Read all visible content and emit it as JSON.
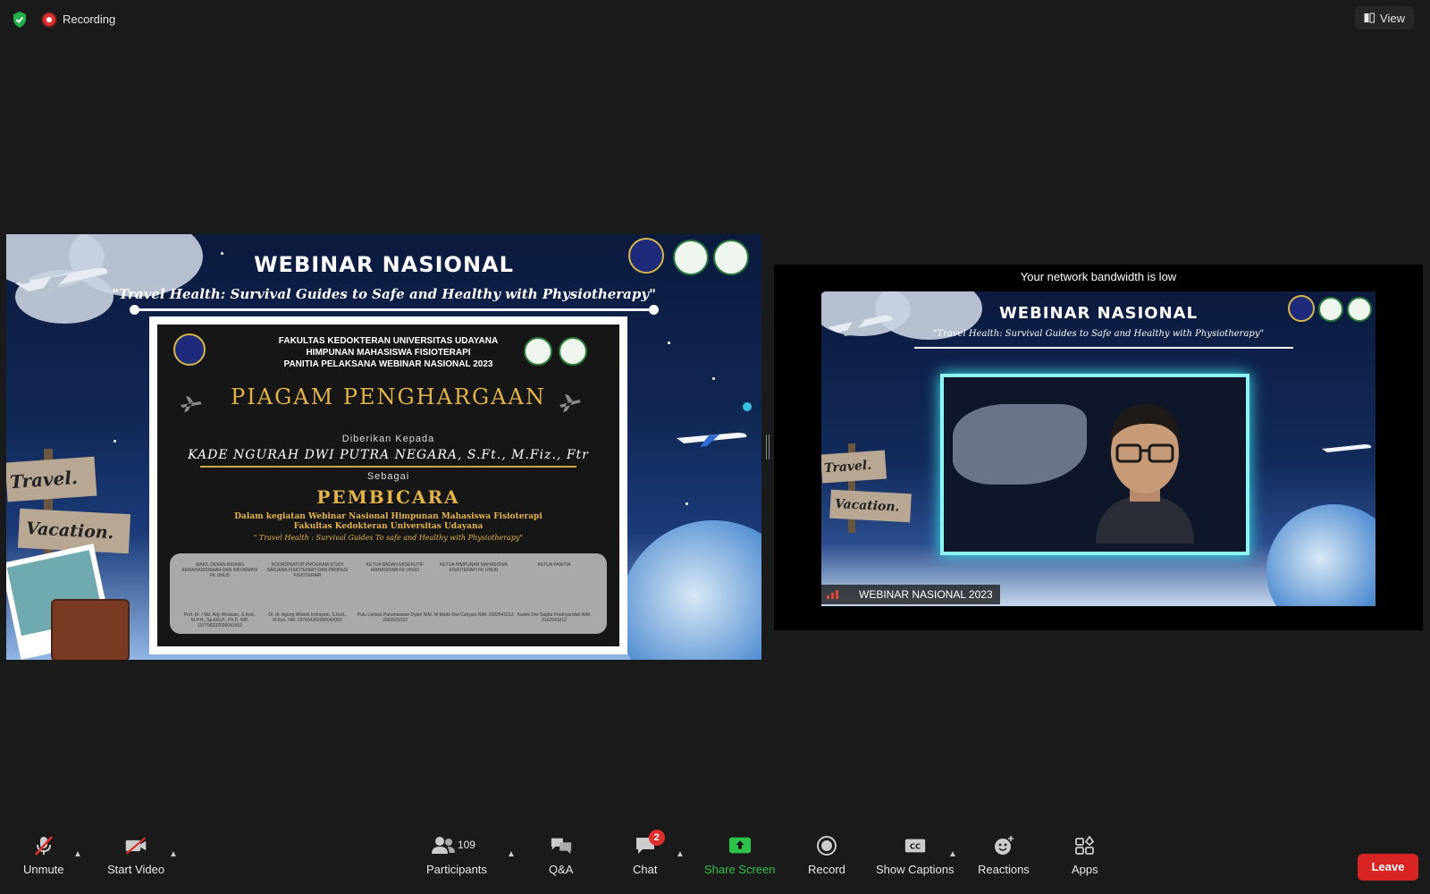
{
  "header": {
    "recording_label": "Recording",
    "view_label": "View"
  },
  "shared_slide": {
    "title": "WEBINAR NASIONAL",
    "subtitle": "\"Travel Health: Survival Guides to Safe and Healthy with Physiotherapy\"",
    "certificate": {
      "org_lines": [
        "FAKULTAS KEDOKTERAN UNIVERSITAS UDAYANA",
        "HIMPUNAN MAHASISWA FISIOTERAPI",
        "PANITIA PELAKSANA WEBINAR NASIONAL 2023"
      ],
      "title": "PIAGAM PENGHARGAAN",
      "given_to": "Diberikan Kepada",
      "name": "KADE NGURAH DWI PUTRA NEGARA, S.Ft., M.Fiz., Ftr",
      "as_label": "Sebagai",
      "role": "PEMBICARA",
      "desc_line1": "Dalam kegiatan Webinar Nasional Himpunan Mahasiswa Fisioterapi",
      "desc_line2": "Fakultas Kedokteran Universitas Udayana",
      "desc_theme": "\" Travel Health : Survival Guides To safe and Healthy with Physiotherapy\"",
      "signatories": [
        {
          "role": "WAKIL DEKAN BIDANG KEMAHASISWAAN DAN INFORMASI FK UNUD",
          "name": "Prof. Dr. I Md. Ady Wirawan, S.Ked., M.P.H., Sp.KKLP., Ph.D. NIP. 197708232006041002"
        },
        {
          "role": "KOORDINATOR PROGRAM STUDI SARJANA FISIOTERAPI DAN PROFESI FISIOTERAPI",
          "name": "Dr. dr. Agung Wiwiek Indrayani, S.Ked., M.Kes. NIP. 197604262006042002"
        },
        {
          "role": "KETUA BADAN EKSEKUTIF MAHASISWA FK UNUD",
          "name": "Putu Larissa Paramaswari Dyani NIM. 2002531022"
        },
        {
          "role": "KETUA HIMPUNAN MAHASISWA FISIOTERAPI FK UNUD",
          "name": "Ni Made Dwi Cahyani NIM. 2002541012"
        },
        {
          "role": "KETUA PANITIA",
          "name": "Kadek Dwi Sagita Pradnyandari NIM. 2102541012"
        }
      ]
    },
    "decor_text": [
      "Travel.",
      "Vacation."
    ]
  },
  "participant_tile": {
    "notice": "Your network bandwidth is low",
    "video_title": "WEBINAR NASIONAL",
    "video_subtitle": "\"Travel Health: Survival Guides to Safe and Healthy with Physiotherapy\"",
    "decor_text": [
      "Travel.",
      "Vacation."
    ],
    "name": "WEBINAR NASIONAL 2023"
  },
  "toolbar": {
    "unmute": "Unmute",
    "start_video": "Start Video",
    "participants": "Participants",
    "participant_count": "109",
    "qa": "Q&A",
    "chat": "Chat",
    "chat_badge": "2",
    "share_screen": "Share Screen",
    "record": "Record",
    "show_captions": "Show Captions",
    "reactions": "Reactions",
    "apps": "Apps",
    "leave": "Leave"
  },
  "colors": {
    "share_green": "#2ec34b",
    "leave_red": "#d92424",
    "badge_red": "#e02f2f",
    "gold": "#e3b34a",
    "glow": "#8ff4f6"
  }
}
